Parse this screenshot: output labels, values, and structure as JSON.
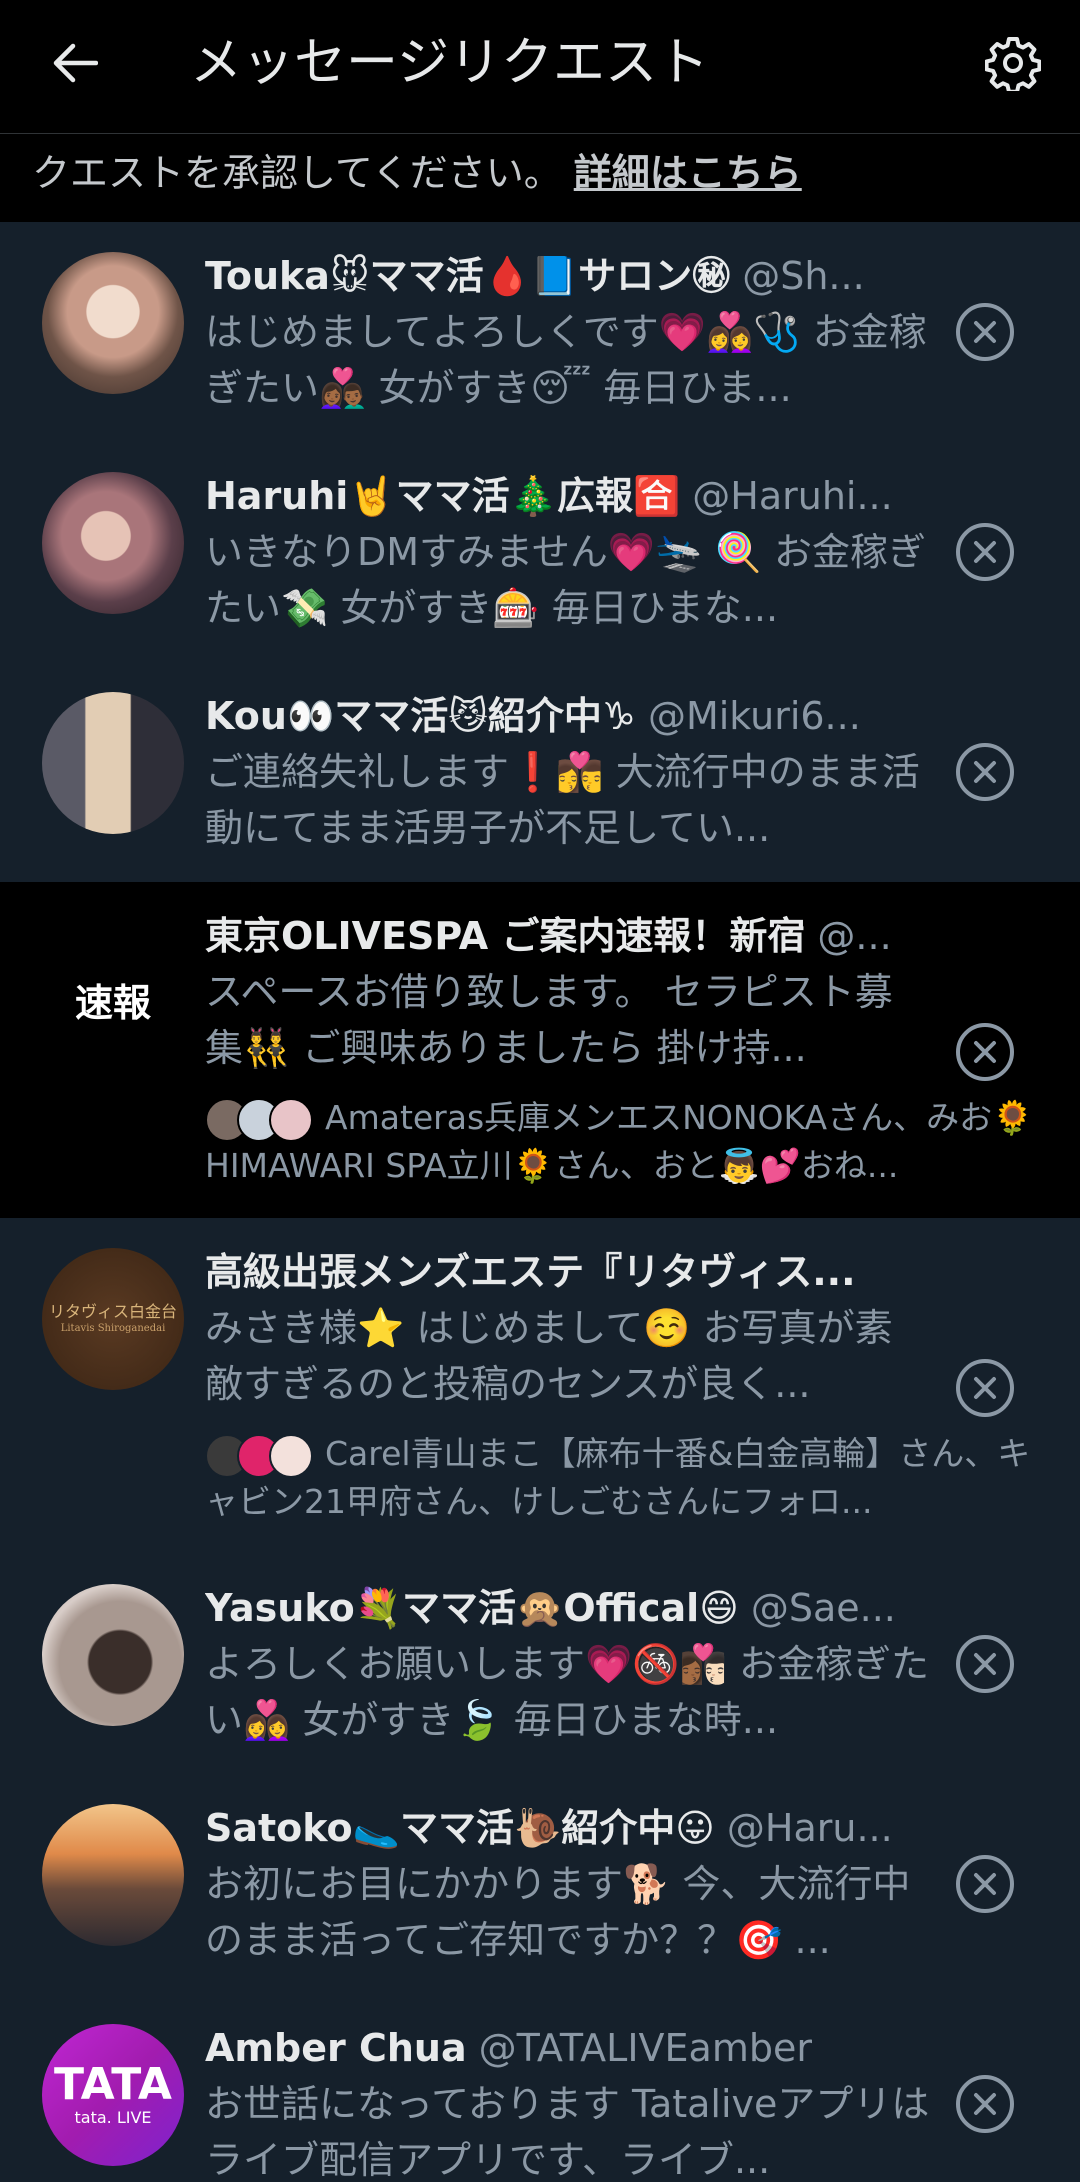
{
  "header": {
    "title": "メッセージリクエスト"
  },
  "notice": {
    "text": "クエストを承認してください。",
    "link": "詳細はこちら"
  },
  "requests": [
    {
      "name": "Touka🐭ママ活🩸📘サロン㊙",
      "handle": "@Sh...",
      "preview": "はじめましてよろしくです💗👩‍❤️‍👩🩺 お金稼ぎたい👩🏾‍❤️‍👨🏾 女がすき😴 毎日ひま...",
      "avatar_colors": [
        "#e8c9b8",
        "#8a6a5a"
      ]
    },
    {
      "name": "Haruhi🤘ママ活🎄広報🈴",
      "handle": "@Haruhi...",
      "preview": "いきなりDMすみません💗🛬 🍭 お金稼ぎたい💸 女がすき🎰 毎日ひまな...",
      "avatar_colors": [
        "#c9a7a0",
        "#3a2a30"
      ]
    },
    {
      "name": "Kou👀ママ活😼紹介中♑",
      "handle": "@Mikuri6...",
      "preview": "ご連絡失礼します❗👩‍❤️‍💋‍👨 大流行中のまま活動にてまま活男子が不足してい...",
      "avatar_colors": [
        "#d9c2a8",
        "#4b4b55"
      ]
    },
    {
      "name": "東京OLIVESPA ご案内速報！新宿",
      "handle": "@...",
      "preview": "スペースお借り致します。 セラピスト募集👯‍♂️ ご興味ありましたら 掛け持...",
      "avatar_text": "速報",
      "followers": "Amateras兵庫メンエスNONOKAさん、みお🌻HIMAWARI SPA立川🌻さん、おと👼💕おね...",
      "dark": true
    },
    {
      "name": "高級出張メンズエステ『リタヴィス...",
      "handle": "",
      "preview": "みさき様⭐ はじめまして☺️ お写真が素敵すぎるのと投稿のセンスが良く...",
      "avatar_text": "リタヴィス白金台",
      "avatar_subtext": "Litavis Shiroganedai",
      "followers": "Carel青山まこ【麻布十番&白金高輪】さん、キャビン21甲府さん、けしごむさんにフォロ..."
    },
    {
      "name": "Yasuko💐ママ活🙊Offical😄",
      "handle": "@Sae...",
      "preview": "よろしくお願いします💗🚳👩🏾‍❤️‍💋‍👨🏻 お金稼ぎたい👩‍❤️‍👩 女がすき🍃 毎日ひまな時...",
      "avatar_colors": [
        "#c9b8b0",
        "#3a2e2a"
      ]
    },
    {
      "name": "Satoko🥿ママ活🐌紹介中😛",
      "handle": "@Haru...",
      "preview": "お初にお目にかかります🐕 今、大流行中のまま活ってご存知ですか？？🎯 ...",
      "avatar_colors": [
        "#e0a060",
        "#2d3a48"
      ]
    },
    {
      "name": "Amber Chua",
      "handle": "@TATALIVEamber",
      "preview": "お世話になっております Tataliveアプリはライブ配信アプリです、ライブ...",
      "avatar_text": "TATA",
      "avatar_subtext": "tata. LIVE"
    }
  ]
}
